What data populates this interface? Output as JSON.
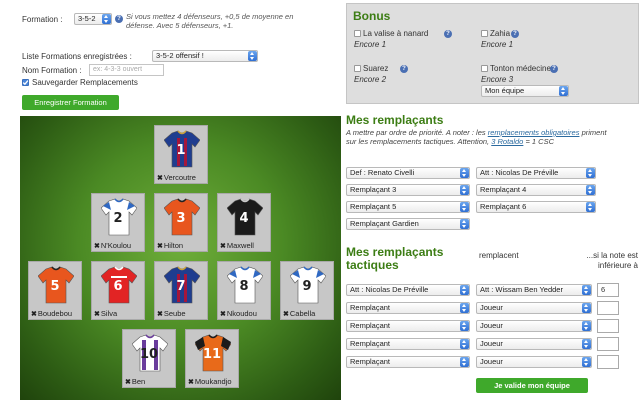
{
  "formation": {
    "label": "Formation :",
    "selected": "3-5-2",
    "note": "Si vous mettez 4 défenseurs, +0,5 de moyenne en défense. Avec 5 défenseurs, +1."
  },
  "saved": {
    "list_label": "Liste Formations enregistrées :",
    "list_selected": "3-5-2 offensif !",
    "name_label": "Nom Formation :",
    "name_placeholder": "ex: 4-3-3 ouvert",
    "save_subs_label": "Sauvegarder Remplacements",
    "save_button": "Enregistrer Formation"
  },
  "bonus": {
    "title": "Bonus",
    "items": [
      {
        "name": "La valise à nanard",
        "count": "Encore 1"
      },
      {
        "name": "Zahia",
        "count": "Encore 1"
      },
      {
        "name": "Suarez",
        "count": "Encore 2"
      },
      {
        "name": "Tonton médecine",
        "count": "Encore 3"
      }
    ],
    "team_select": "Mon équipe"
  },
  "players": [
    {
      "num": "1",
      "name": "Vercoutre",
      "jersey": "barca"
    },
    {
      "num": "2",
      "name": "N'Koulou",
      "jersey": "white"
    },
    {
      "num": "3",
      "name": "Hilton",
      "jersey": "orange"
    },
    {
      "num": "4",
      "name": "Maxwell",
      "jersey": "black"
    },
    {
      "num": "5",
      "name": "Boudebou",
      "jersey": "orange"
    },
    {
      "num": "6",
      "name": "Silva",
      "jersey": "red"
    },
    {
      "num": "7",
      "name": "Seube",
      "jersey": "barca"
    },
    {
      "num": "8",
      "name": "Nkoudou",
      "jersey": "white"
    },
    {
      "num": "9",
      "name": "Cabella",
      "jersey": "white"
    },
    {
      "num": "10",
      "name": "Ben",
      "jersey": "purple"
    },
    {
      "num": "11",
      "name": "Moukandjo",
      "jersey": "orangeblack"
    }
  ],
  "subs": {
    "title": "Mes remplaçants",
    "desc_1": "A mettre par ordre de priorité. A noter : les",
    "desc_link": "remplacements obligatoires",
    "desc_2": "priment sur les remplacements tactiques.",
    "desc_3": "Attention,",
    "desc_link2": "3 Rotaldo",
    "desc_4": "= 1 CSC",
    "selects": [
      "Def : Renato Civelli",
      "Att : Nicolas De Préville",
      "Remplaçant 3",
      "Remplaçant 4",
      "Remplaçant 5",
      "Remplaçant 6",
      "Remplaçant Gardien"
    ]
  },
  "tactical": {
    "title": "Mes remplaçants tactiques",
    "col_replace": "remplacent",
    "col_if": "...si la note est inférieure à",
    "rows": [
      {
        "sub": "Att : Nicolas De Préville",
        "replaced": "Att : Wissam Ben Yedder",
        "note": "6"
      },
      {
        "sub": "Remplaçant",
        "replaced": "Joueur",
        "note": ""
      },
      {
        "sub": "Remplaçant",
        "replaced": "Joueur",
        "note": ""
      },
      {
        "sub": "Remplaçant",
        "replaced": "Joueur",
        "note": ""
      },
      {
        "sub": "Remplaçant",
        "replaced": "Joueur",
        "note": ""
      }
    ],
    "validate_button": "Je valide mon équipe"
  }
}
